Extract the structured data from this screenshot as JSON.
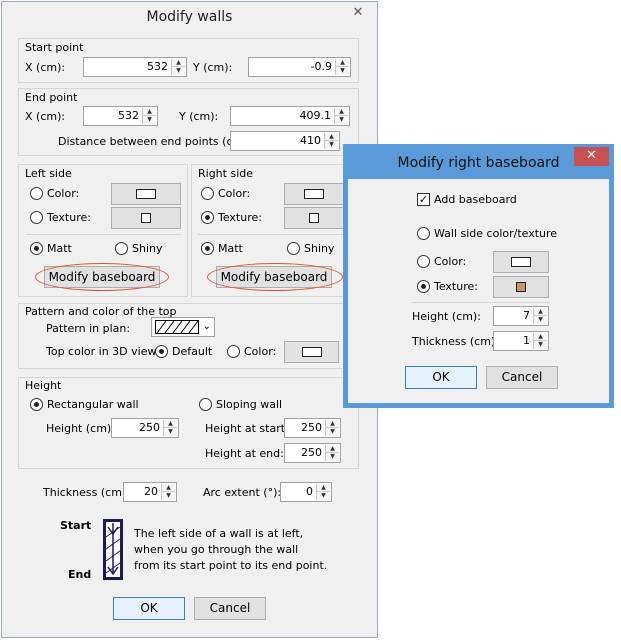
{
  "main_dialog": {
    "title": "Modify walls",
    "close_glyph": "✕",
    "start_point": {
      "section_label": "Start point",
      "x_label": "X (cm):",
      "x_value": "532",
      "y_label": "Y (cm):",
      "y_value": "-0.9"
    },
    "end_point": {
      "section_label": "End point",
      "x_label": "X (cm):",
      "x_value": "532",
      "y_label": "Y (cm):",
      "y_value": "409.1",
      "distance_label": "Distance between end points (cm):",
      "distance_value": "410"
    },
    "left_side": {
      "section_label": "Left side",
      "color_label": "Color:",
      "texture_label": "Texture:",
      "matt_label": "Matt",
      "shiny_label": "Shiny",
      "baseboard_button": "Modify baseboard"
    },
    "right_side": {
      "section_label": "Right side",
      "color_label": "Color:",
      "texture_label": "Texture:",
      "matt_label": "Matt",
      "shiny_label": "Shiny",
      "baseboard_button": "Modify baseboard"
    },
    "top": {
      "section_label": "Pattern and color of the top",
      "pattern_label": "Pattern in plan:",
      "top_color_label": "Top color in 3D view:",
      "default_label": "Default",
      "color_label": "Color:"
    },
    "height": {
      "section_label": "Height",
      "rect_label": "Rectangular wall",
      "sloping_label": "Sloping wall",
      "height_label": "Height (cm):",
      "height_value": "250",
      "start_label": "Height at start:",
      "start_value": "250",
      "end_label": "Height at end:",
      "end_value": "250"
    },
    "thickness_label": "Thickness (cm):",
    "thickness_value": "20",
    "arc_label": "Arc extent (°):",
    "arc_value": "0",
    "diagram": {
      "start_label": "Start",
      "end_label": "End",
      "line1": "The left side of a wall is at left,",
      "line2": "when you go through the wall",
      "line3": "from its start point to its end point."
    },
    "ok_label": "OK",
    "cancel_label": "Cancel"
  },
  "baseboard_dialog": {
    "title": "Modify right baseboard",
    "close_glyph": "✕",
    "add_label": "Add baseboard",
    "wall_side_label": "Wall side color/texture",
    "color_label": "Color:",
    "texture_label": "Texture:",
    "height_label": "Height (cm):",
    "height_value": "7",
    "thickness_label": "Thickness (cm):",
    "thickness_value": "1",
    "ok_label": "OK",
    "cancel_label": "Cancel"
  },
  "colors": {
    "highlight_oval": "#e0502a",
    "close_button": "#c75050",
    "texture_swatch": "#c8956a",
    "baseboard_frame": "#4a8fd4"
  }
}
